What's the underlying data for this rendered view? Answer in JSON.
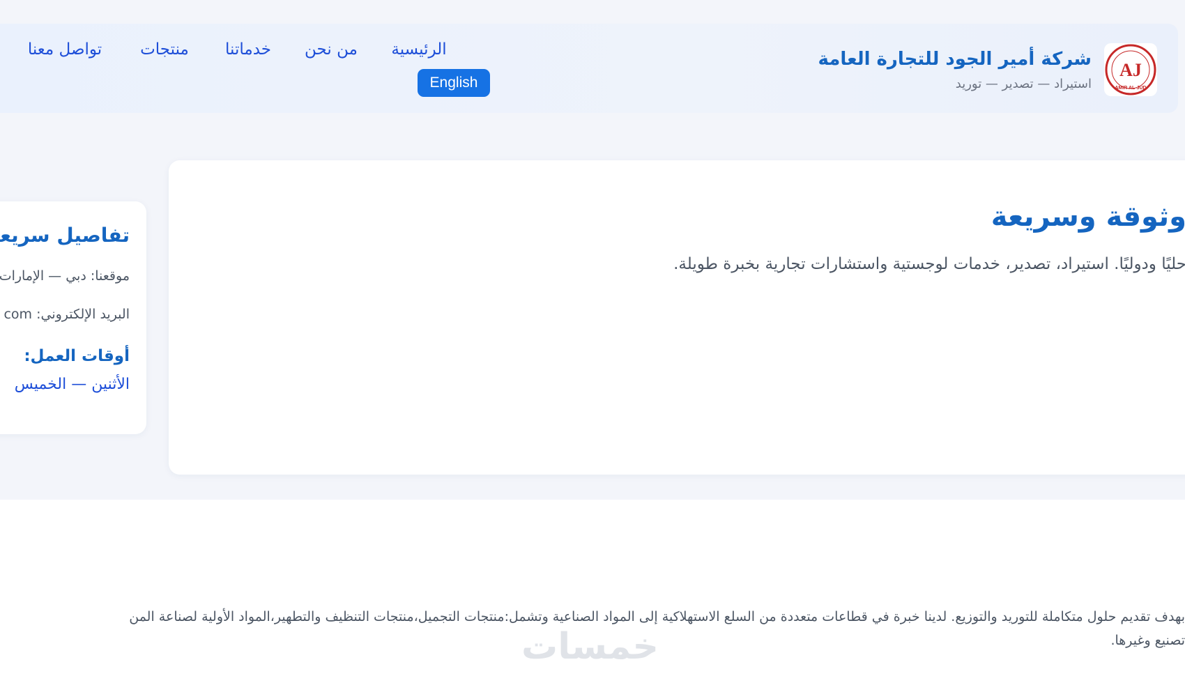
{
  "brand": {
    "name": "شركة أمير الجود للتجارة العامة",
    "tagline": "استيراد — تصدير — توريد",
    "logo_text": "AJ",
    "logo_caption": "AMIR AL-JUD"
  },
  "nav": {
    "items": [
      {
        "label": "الرئيسية"
      },
      {
        "label": "من نحن"
      },
      {
        "label": "خدماتنا"
      },
      {
        "label": "منتجات"
      },
      {
        "label": "تواصل معنا"
      }
    ],
    "language_button": "English"
  },
  "hero": {
    "title": "وثوقة وسريعة",
    "description": "حليًا ودوليًا. استيراد، تصدير، خدمات لوجستية واستشارات تجارية بخبرة طويلة."
  },
  "details": {
    "title": "تفاصيل سريعة",
    "location": "موقعنا: دبي — الإمارات",
    "email": "البريد الإلكتروني: com",
    "hours_label": "أوقات العمل:",
    "hours": "الأثنين — الخميس"
  },
  "about": {
    "line1": "بهدف تقديم حلول متكاملة للتوريد والتوزيع. لدينا خبرة في قطاعات متعددة من السلع الاستهلاكية إلى المواد الصناعية وتشمل:منتجات التجميل،منتجات التنظيف والتطهير،المواد الأولية لصناعة المن",
    "line2": "تصنيع وغيرها."
  },
  "watermark": "خمسات",
  "colors": {
    "primary": "#1565c0",
    "link": "#1d4ed8",
    "button": "#1672e4",
    "page_bg": "#f3f5fa",
    "header_bg": "#eaf1fd",
    "logo_red": "#c62828"
  }
}
